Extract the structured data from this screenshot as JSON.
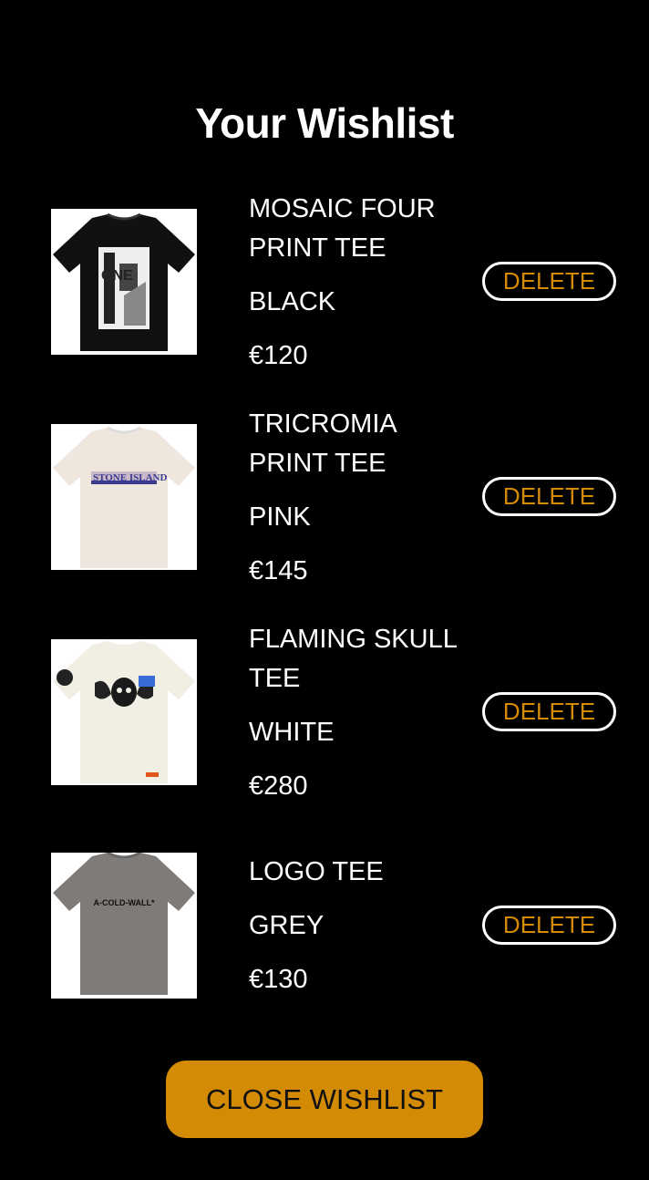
{
  "page": {
    "title": "Your Wishlist"
  },
  "items": [
    {
      "name": "MOSAIC FOUR PRINT TEE",
      "color": "BLACK",
      "price": "€120",
      "delete_label": "DELETE",
      "image": "black-tee-stone-island-mosaic"
    },
    {
      "name": "TRICROMIA PRINT TEE",
      "color": "PINK",
      "price": "€145",
      "delete_label": "DELETE",
      "image": "pink-tee-stone-island-logo"
    },
    {
      "name": "FLAMING SKULL TEE",
      "color": "WHITE",
      "price": "€280",
      "delete_label": "DELETE",
      "image": "white-tee-flaming-skull"
    },
    {
      "name": "LOGO TEE",
      "color": "GREY",
      "price": "€130",
      "delete_label": "DELETE",
      "image": "grey-tee-a-cold-wall-logo"
    }
  ],
  "footer": {
    "close_label": "CLOSE WISHLIST"
  },
  "colors": {
    "background": "#000000",
    "accent": "#d38a05",
    "text": "#ffffff"
  }
}
